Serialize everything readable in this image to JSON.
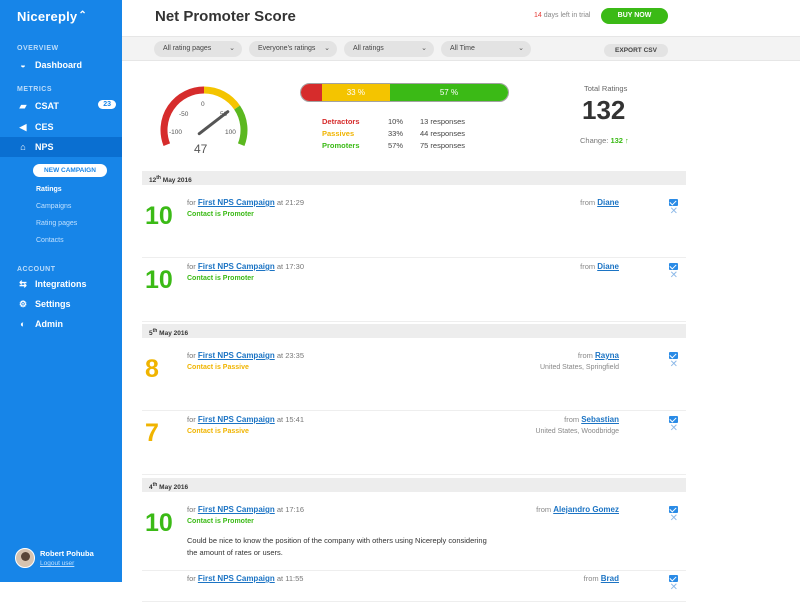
{
  "sidebar": {
    "logo": "Nicereply",
    "overview_label": "OVERVIEW",
    "dashboard": "Dashboard",
    "metrics_label": "METRICS",
    "csat": "CSAT",
    "csat_badge": "23",
    "ces": "CES",
    "nps": "NPS",
    "new_campaign": "NEW CAMPAIGN",
    "sub": [
      "Ratings",
      "Campaigns",
      "Rating pages",
      "Contacts"
    ],
    "account_label": "ACCOUNT",
    "integrations": "Integrations",
    "settings": "Settings",
    "admin": "Admin",
    "user_name": "Robert Pohuba",
    "logout": "Logout user"
  },
  "header": {
    "title": "Net Promoter Score",
    "trial_days": "14",
    "trial_text": "days left in trial",
    "buy_now": "BUY NOW"
  },
  "filters": {
    "rating_pages": "All rating pages",
    "everyones": "Everyone's ratings",
    "ratings": "All ratings",
    "time": "All Time",
    "export": "EXPORT CSV"
  },
  "gauge": {
    "score": "47",
    "ticks": [
      "-50",
      "0",
      "50",
      "-100",
      "100"
    ],
    "value": 47,
    "colors": {
      "red": "#d62c2c",
      "yellow": "#f4c400",
      "green": "#5bb81f"
    }
  },
  "distribution": {
    "bar": {
      "red_share": 0.1,
      "yellow_share": 0.33,
      "green_share": 0.57,
      "yellow_label": "33 %",
      "green_label": "57 %"
    },
    "rows": [
      {
        "label": "Detractors",
        "pct": "10%",
        "resp": "13 responses",
        "color": "#d62c2c"
      },
      {
        "label": "Passives",
        "pct": "33%",
        "resp": "44 responses",
        "color": "#f0b400"
      },
      {
        "label": "Promoters",
        "pct": "57%",
        "resp": "75 responses",
        "color": "#3bba16"
      }
    ]
  },
  "totals": {
    "label": "Total Ratings",
    "value": "132",
    "change_label": "Change:",
    "change_value": "132"
  },
  "feed": {
    "dates": [
      {
        "day": "12",
        "sup": "th",
        "month": "May 2016"
      },
      {
        "day": "5",
        "sup": "th",
        "month": "May 2016"
      },
      {
        "day": "4",
        "sup": "th",
        "month": "May 2016"
      }
    ],
    "for_word": "for",
    "at_word": "at",
    "from_word": "from",
    "entries": [
      {
        "score": "10",
        "campaign": "First NPS Campaign",
        "time": "21:29",
        "status": "Contact is Promoter",
        "who": "Diane",
        "loc": "",
        "comment": "",
        "color": "#3bba16"
      },
      {
        "score": "10",
        "campaign": "First NPS Campaign",
        "time": "17:30",
        "status": "Contact is Promoter",
        "who": "Diane",
        "loc": "",
        "comment": "",
        "color": "#3bba16"
      },
      {
        "score": "8",
        "campaign": "First NPS Campaign",
        "time": "23:35",
        "status": "Contact is Passive",
        "who": "Rayna",
        "loc": "United States, Springfield",
        "comment": "",
        "color": "#f0b400"
      },
      {
        "score": "7",
        "campaign": "First NPS Campaign",
        "time": "15:41",
        "status": "Contact is Passive",
        "who": "Sebastian",
        "loc": "United States, Woodbridge",
        "comment": "",
        "color": "#f0b400"
      },
      {
        "score": "10",
        "campaign": "First NPS Campaign",
        "time": "17:16",
        "status": "Contact is Promoter",
        "who": "Alejandro Gomez",
        "loc": "",
        "comment": "Could be nice to know the position of the company with others using Nicereply considering the amount of rates or users.",
        "color": "#3bba16"
      },
      {
        "score": "",
        "campaign": "First NPS Campaign",
        "time": "11:55",
        "status": "",
        "who": "Brad",
        "loc": "",
        "comment": "",
        "color": "#3bba16"
      }
    ]
  }
}
